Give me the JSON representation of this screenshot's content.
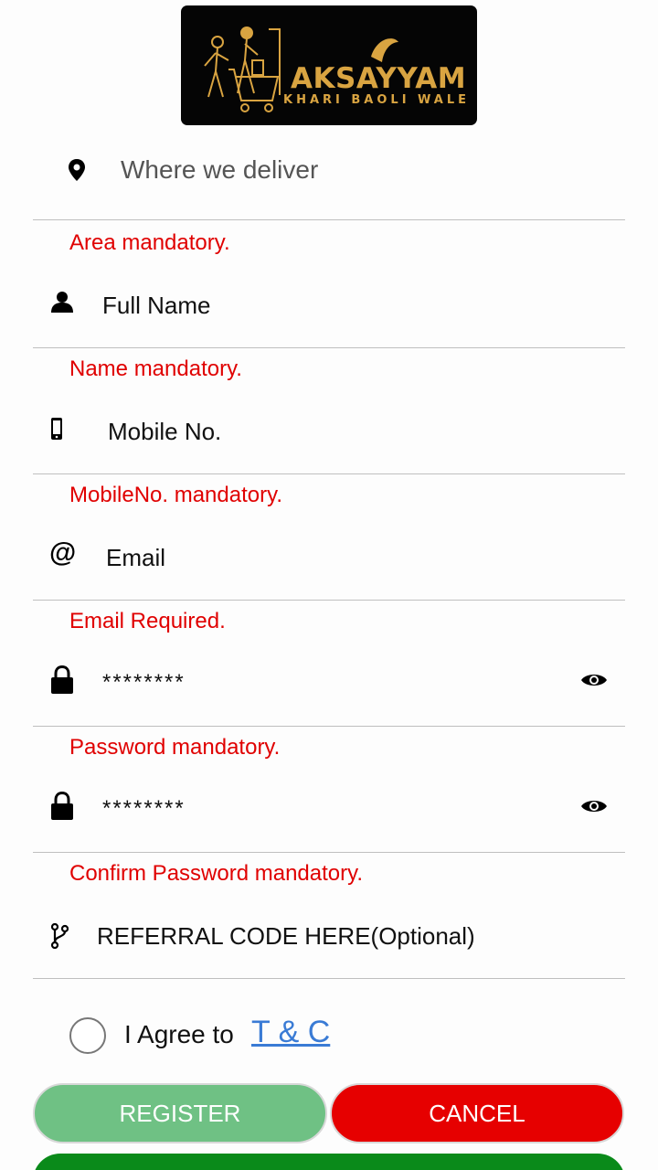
{
  "logo": {
    "title": "AKSAYYAM",
    "subtitle": "KHARI BAOLI WALE",
    "alt_icon": "shopping-cart-logo"
  },
  "fields": {
    "area": {
      "placeholder": "Where we deliver",
      "icon": "location-pin-icon",
      "error": "Area mandatory."
    },
    "name": {
      "placeholder": "Full Name",
      "icon": "person-icon",
      "error": "Name mandatory."
    },
    "mobile": {
      "placeholder": "Mobile No.",
      "icon": "mobile-phone-icon",
      "error": "MobileNo. mandatory."
    },
    "email": {
      "placeholder": "Email",
      "icon": "at-sign-icon",
      "error": "Email Required."
    },
    "password": {
      "value": "********",
      "icon": "lock-icon",
      "error": "Password mandatory."
    },
    "confirm_password": {
      "value": "********",
      "icon": "lock-icon",
      "error": "Confirm Password mandatory."
    },
    "referral": {
      "placeholder": "REFERRAL CODE HERE(Optional)",
      "icon": "branch-icon"
    }
  },
  "agree": {
    "label": "I Agree to",
    "link": "T & C"
  },
  "buttons": {
    "register": "REGISTER",
    "cancel": "CANCEL"
  },
  "colors": {
    "error": "#e00000",
    "register": "#6fc184",
    "cancel": "#e60000",
    "link": "#3a7bd5",
    "gold": "#d9a441"
  }
}
